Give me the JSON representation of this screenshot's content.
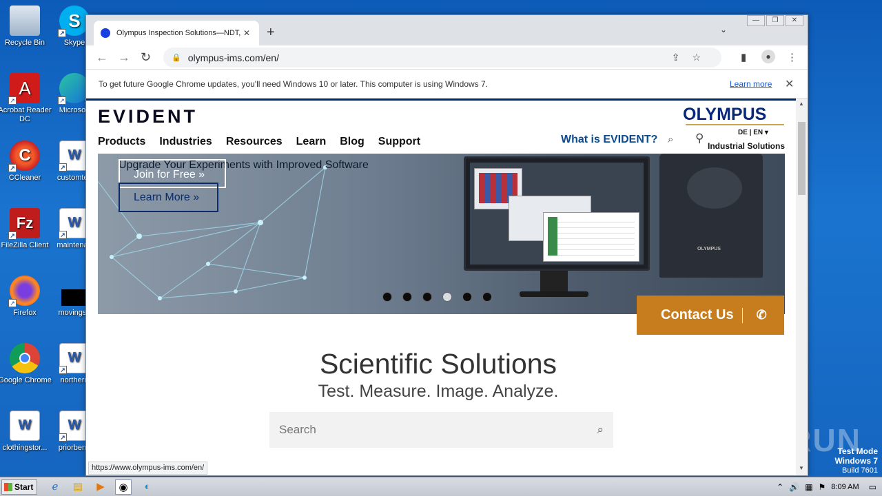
{
  "desktop": {
    "icons": [
      {
        "label": "Recycle Bin",
        "glyph": "🗑"
      },
      {
        "label": "Skype",
        "glyph": "S"
      },
      {
        "label": "Acrobat Reader DC",
        "glyph": "A"
      },
      {
        "label": "Microsoft",
        "glyph": "e"
      },
      {
        "label": "CCleaner",
        "glyph": "C"
      },
      {
        "label": "customtes",
        "glyph": "W"
      },
      {
        "label": "FileZilla Client",
        "glyph": "Fz"
      },
      {
        "label": "maintenan",
        "glyph": "W"
      },
      {
        "label": "Firefox",
        "glyph": "🦊"
      },
      {
        "label": "movingsu",
        "glyph": ""
      },
      {
        "label": "Google Chrome",
        "glyph": "◉"
      },
      {
        "label": "northern",
        "glyph": "W"
      },
      {
        "label": "clothingstor...",
        "glyph": "W"
      },
      {
        "label": "priorbene",
        "glyph": "W"
      }
    ],
    "watermark": "ANY ▷ RUN",
    "test_mode": {
      "line1": "Test Mode",
      "line2": "Windows 7",
      "line3": "Build 7601"
    }
  },
  "browser": {
    "tab_title": "Olympus Inspection Solutions—NDT, ",
    "tab_close": "✕",
    "new_tab": "+",
    "tab_menu": "⌄",
    "window_controls": {
      "minimize": "—",
      "restore": "❐",
      "close": "✕"
    },
    "url": "olympus-ims.com/en/",
    "infobar_text": "To get future Google Chrome updates, you'll need Windows 10 or later. This computer is using Windows 7.",
    "infobar_link": "Learn more",
    "status_url": "https://www.olympus-ims.com/en/"
  },
  "site": {
    "logo": "EVIDENT",
    "nav": [
      "Products",
      "Industries",
      "Resources",
      "Learn",
      "Blog",
      "Support"
    ],
    "what_is": "What is EVIDENT?",
    "brand": "OLYMPUS",
    "langs": "DE  |  EN ▾",
    "industrial": "Industrial Solutions",
    "hero": {
      "headline": "Upgrade Your Experiments with Improved Software",
      "join": "Join for Free  »",
      "learn_more": "Learn More  »",
      "microscope_brand": "OLYMPUS",
      "slides": 6,
      "active_slide": 4
    },
    "contact": "Contact Us",
    "title": "Scientific Solutions",
    "subtitle": "Test. Measure. Image. Analyze.",
    "search_placeholder": "Search"
  },
  "taskbar": {
    "start": "Start",
    "time": "8:09 AM"
  },
  "colors": {
    "accent_orange": "#c77d1d",
    "evident_navy": "#002e6d",
    "olympus_blue": "#08287a"
  }
}
